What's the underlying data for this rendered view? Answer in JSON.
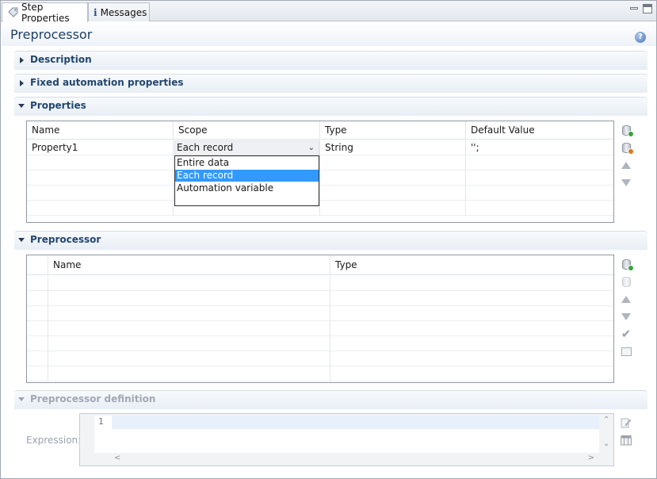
{
  "tabs": [
    {
      "label": "Step Properties",
      "icon": "tag-icon",
      "active": true
    },
    {
      "label": "Messages",
      "icon": "info-icon",
      "active": false
    }
  ],
  "page_title": "Preprocessor",
  "sections": {
    "description": "Description",
    "fixed": "Fixed automation properties",
    "properties": "Properties",
    "preprocessor": "Preprocessor",
    "definition": "Preprocessor definition"
  },
  "properties_table": {
    "columns": [
      "Name",
      "Scope",
      "Type",
      "Default Value"
    ],
    "rows": [
      {
        "name": "Property1",
        "scope": "Each record",
        "type": "String",
        "default": "'';"
      }
    ]
  },
  "scope_dropdown": {
    "options": [
      "Entire data",
      "Each record",
      "Automation variable"
    ],
    "selected": "Each record"
  },
  "preprocessor_table": {
    "columns": [
      "Name",
      "Type"
    ]
  },
  "expression": {
    "label": "Expression:",
    "line_number": "1"
  },
  "colors": {
    "section_title": "#23466e",
    "page_title": "#1f3f66",
    "selection": "#3399ff"
  }
}
